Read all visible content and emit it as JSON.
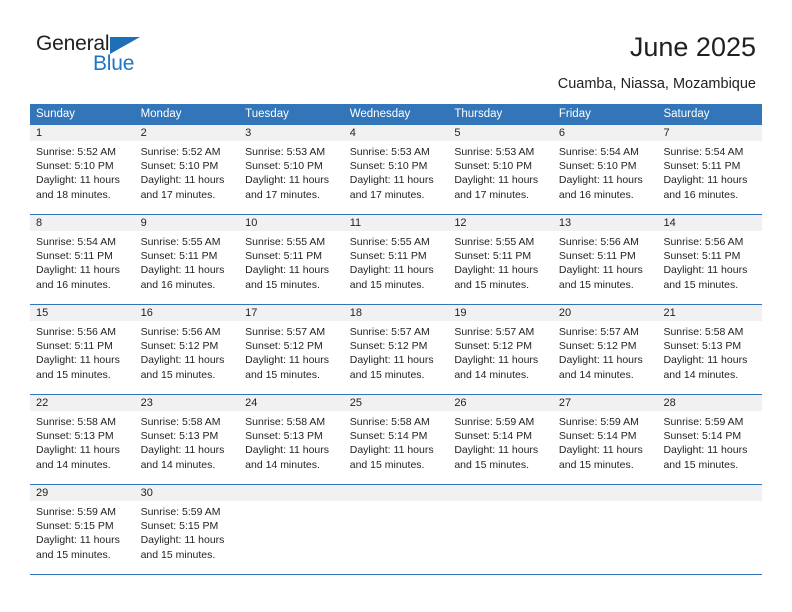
{
  "brand": {
    "name_top": "General",
    "name_bottom": "Blue",
    "triangle_color": "#1e6fb8",
    "blue_text_color": "#1e77c4"
  },
  "header": {
    "title": "June 2025",
    "subtitle": "Cuamba, Niassa, Mozambique"
  },
  "theme": {
    "header_blue": "#3275b8",
    "daynum_band": "#f1f1f1",
    "text": "#231f20"
  },
  "weekdays": [
    "Sunday",
    "Monday",
    "Tuesday",
    "Wednesday",
    "Thursday",
    "Friday",
    "Saturday"
  ],
  "weeks": [
    [
      {
        "day": "1",
        "sunrise": "Sunrise: 5:52 AM",
        "sunset": "Sunset: 5:10 PM",
        "daylight": "Daylight: 11 hours and 18 minutes."
      },
      {
        "day": "2",
        "sunrise": "Sunrise: 5:52 AM",
        "sunset": "Sunset: 5:10 PM",
        "daylight": "Daylight: 11 hours and 17 minutes."
      },
      {
        "day": "3",
        "sunrise": "Sunrise: 5:53 AM",
        "sunset": "Sunset: 5:10 PM",
        "daylight": "Daylight: 11 hours and 17 minutes."
      },
      {
        "day": "4",
        "sunrise": "Sunrise: 5:53 AM",
        "sunset": "Sunset: 5:10 PM",
        "daylight": "Daylight: 11 hours and 17 minutes."
      },
      {
        "day": "5",
        "sunrise": "Sunrise: 5:53 AM",
        "sunset": "Sunset: 5:10 PM",
        "daylight": "Daylight: 11 hours and 17 minutes."
      },
      {
        "day": "6",
        "sunrise": "Sunrise: 5:54 AM",
        "sunset": "Sunset: 5:10 PM",
        "daylight": "Daylight: 11 hours and 16 minutes."
      },
      {
        "day": "7",
        "sunrise": "Sunrise: 5:54 AM",
        "sunset": "Sunset: 5:11 PM",
        "daylight": "Daylight: 11 hours and 16 minutes."
      }
    ],
    [
      {
        "day": "8",
        "sunrise": "Sunrise: 5:54 AM",
        "sunset": "Sunset: 5:11 PM",
        "daylight": "Daylight: 11 hours and 16 minutes."
      },
      {
        "day": "9",
        "sunrise": "Sunrise: 5:55 AM",
        "sunset": "Sunset: 5:11 PM",
        "daylight": "Daylight: 11 hours and 16 minutes."
      },
      {
        "day": "10",
        "sunrise": "Sunrise: 5:55 AM",
        "sunset": "Sunset: 5:11 PM",
        "daylight": "Daylight: 11 hours and 15 minutes."
      },
      {
        "day": "11",
        "sunrise": "Sunrise: 5:55 AM",
        "sunset": "Sunset: 5:11 PM",
        "daylight": "Daylight: 11 hours and 15 minutes."
      },
      {
        "day": "12",
        "sunrise": "Sunrise: 5:55 AM",
        "sunset": "Sunset: 5:11 PM",
        "daylight": "Daylight: 11 hours and 15 minutes."
      },
      {
        "day": "13",
        "sunrise": "Sunrise: 5:56 AM",
        "sunset": "Sunset: 5:11 PM",
        "daylight": "Daylight: 11 hours and 15 minutes."
      },
      {
        "day": "14",
        "sunrise": "Sunrise: 5:56 AM",
        "sunset": "Sunset: 5:11 PM",
        "daylight": "Daylight: 11 hours and 15 minutes."
      }
    ],
    [
      {
        "day": "15",
        "sunrise": "Sunrise: 5:56 AM",
        "sunset": "Sunset: 5:11 PM",
        "daylight": "Daylight: 11 hours and 15 minutes."
      },
      {
        "day": "16",
        "sunrise": "Sunrise: 5:56 AM",
        "sunset": "Sunset: 5:12 PM",
        "daylight": "Daylight: 11 hours and 15 minutes."
      },
      {
        "day": "17",
        "sunrise": "Sunrise: 5:57 AM",
        "sunset": "Sunset: 5:12 PM",
        "daylight": "Daylight: 11 hours and 15 minutes."
      },
      {
        "day": "18",
        "sunrise": "Sunrise: 5:57 AM",
        "sunset": "Sunset: 5:12 PM",
        "daylight": "Daylight: 11 hours and 15 minutes."
      },
      {
        "day": "19",
        "sunrise": "Sunrise: 5:57 AM",
        "sunset": "Sunset: 5:12 PM",
        "daylight": "Daylight: 11 hours and 14 minutes."
      },
      {
        "day": "20",
        "sunrise": "Sunrise: 5:57 AM",
        "sunset": "Sunset: 5:12 PM",
        "daylight": "Daylight: 11 hours and 14 minutes."
      },
      {
        "day": "21",
        "sunrise": "Sunrise: 5:58 AM",
        "sunset": "Sunset: 5:13 PM",
        "daylight": "Daylight: 11 hours and 14 minutes."
      }
    ],
    [
      {
        "day": "22",
        "sunrise": "Sunrise: 5:58 AM",
        "sunset": "Sunset: 5:13 PM",
        "daylight": "Daylight: 11 hours and 14 minutes."
      },
      {
        "day": "23",
        "sunrise": "Sunrise: 5:58 AM",
        "sunset": "Sunset: 5:13 PM",
        "daylight": "Daylight: 11 hours and 14 minutes."
      },
      {
        "day": "24",
        "sunrise": "Sunrise: 5:58 AM",
        "sunset": "Sunset: 5:13 PM",
        "daylight": "Daylight: 11 hours and 14 minutes."
      },
      {
        "day": "25",
        "sunrise": "Sunrise: 5:58 AM",
        "sunset": "Sunset: 5:14 PM",
        "daylight": "Daylight: 11 hours and 15 minutes."
      },
      {
        "day": "26",
        "sunrise": "Sunrise: 5:59 AM",
        "sunset": "Sunset: 5:14 PM",
        "daylight": "Daylight: 11 hours and 15 minutes."
      },
      {
        "day": "27",
        "sunrise": "Sunrise: 5:59 AM",
        "sunset": "Sunset: 5:14 PM",
        "daylight": "Daylight: 11 hours and 15 minutes."
      },
      {
        "day": "28",
        "sunrise": "Sunrise: 5:59 AM",
        "sunset": "Sunset: 5:14 PM",
        "daylight": "Daylight: 11 hours and 15 minutes."
      }
    ],
    [
      {
        "day": "29",
        "sunrise": "Sunrise: 5:59 AM",
        "sunset": "Sunset: 5:15 PM",
        "daylight": "Daylight: 11 hours and 15 minutes."
      },
      {
        "day": "30",
        "sunrise": "Sunrise: 5:59 AM",
        "sunset": "Sunset: 5:15 PM",
        "daylight": "Daylight: 11 hours and 15 minutes."
      },
      {
        "day": "",
        "sunrise": "",
        "sunset": "",
        "daylight": ""
      },
      {
        "day": "",
        "sunrise": "",
        "sunset": "",
        "daylight": ""
      },
      {
        "day": "",
        "sunrise": "",
        "sunset": "",
        "daylight": ""
      },
      {
        "day": "",
        "sunrise": "",
        "sunset": "",
        "daylight": ""
      },
      {
        "day": "",
        "sunrise": "",
        "sunset": "",
        "daylight": ""
      }
    ]
  ]
}
